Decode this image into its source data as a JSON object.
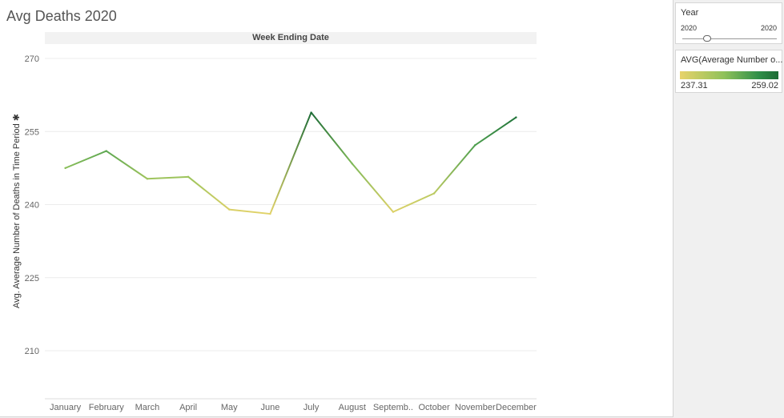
{
  "title": "Avg Deaths 2020",
  "header": "Week Ending Date",
  "ylabel": "Avg. Average Number of Deaths in Time Period",
  "ylabel_marker": "✱",
  "year_filter": {
    "title": "Year",
    "min": "2020",
    "max": "2020"
  },
  "color_legend": {
    "title": "AVG(Average Number o...",
    "min": "237.31",
    "max": "259.02",
    "color_low": "#e8d36a",
    "color_high": "#1c6b35"
  },
  "chart_data": {
    "type": "line",
    "categories": [
      "January",
      "February",
      "March",
      "April",
      "May",
      "June",
      "July",
      "August",
      "Septemb..",
      "October",
      "November",
      "December"
    ],
    "values": [
      247.5,
      251.0,
      245.3,
      245.7,
      239.0,
      238.1,
      258.9,
      248.4,
      238.5,
      242.3,
      252.2,
      257.9
    ],
    "yticks": [
      210,
      225,
      240,
      255,
      270
    ],
    "ylim": [
      198,
      270
    ]
  }
}
